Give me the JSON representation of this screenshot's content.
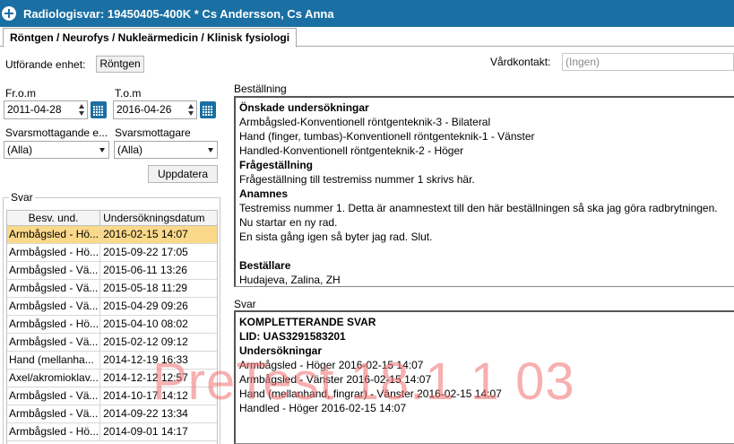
{
  "window": {
    "title": "Radiologisvar: 19450405-400K * Cs Andersson, Cs Anna",
    "icon": "medical-cross-icon"
  },
  "tabs": [
    {
      "label": "Röntgen / Neurofys / Nukleärmedicin / Klinisk fysiologi"
    }
  ],
  "filters": {
    "unit_label": "Utförande enhet:",
    "unit_value": "Röntgen",
    "vardkontakt_label": "Vårdkontakt:",
    "vardkontakt_placeholder": "(Ingen)",
    "from_label": "Fr.o.m",
    "from_value": "2011-04-28",
    "to_label": "T.o.m",
    "to_value": "2016-04-26",
    "recipient_unit_label": "Svarsmottagande e...",
    "recipient_unit_value": "(Alla)",
    "recipient_label": "Svarsmottagare",
    "recipient_value": "(Alla)",
    "update_label": "Uppdatera"
  },
  "answers_list": {
    "group_label": "Svar",
    "columns": [
      "Besv. und.",
      "Undersökningsdatum"
    ],
    "rows": [
      {
        "exam": "Armbågsled - Hö...",
        "date": "2016-02-15 14:07",
        "selected": true
      },
      {
        "exam": "Armbågsled - Hö...",
        "date": "2015-09-22 17:05"
      },
      {
        "exam": "Armbågsled - Vä...",
        "date": "2015-06-11 13:26"
      },
      {
        "exam": "Armbågsled - Vä...",
        "date": "2015-05-18 11:29"
      },
      {
        "exam": "Armbågsled - Vä...",
        "date": "2015-04-29 09:26"
      },
      {
        "exam": "Armbågsled - Hö...",
        "date": "2015-04-10 08:02"
      },
      {
        "exam": "Armbågsled - Vä...",
        "date": "2015-02-12 09:12"
      },
      {
        "exam": "Hand (mellanha...",
        "date": "2014-12-19 16:33"
      },
      {
        "exam": "Axel/akromioklav...",
        "date": "2014-12-12 12:57"
      },
      {
        "exam": "Armbågsled - Vä...",
        "date": "2014-10-17 14:12"
      },
      {
        "exam": "Armbågsled - Vä...",
        "date": "2014-09-22 13:34"
      },
      {
        "exam": "Armbågsled - Hö...",
        "date": "2014-09-01 14:17"
      }
    ]
  },
  "order_panel": {
    "label": "Beställning",
    "lines": [
      {
        "text": "Önskade undersökningar",
        "bold": true
      },
      {
        "text": "Armbågsled-Konventionell röntgenteknik-3 - Bilateral"
      },
      {
        "text": "Hand (finger, tumbas)-Konventionell röntgenteknik-1 - Vänster"
      },
      {
        "text": "Handled-Konventionell röntgenteknik-2 - Höger"
      },
      {
        "text": "Frågeställning",
        "bold": true
      },
      {
        "text": "Frågeställning till testremiss nummer 1 skrivs här."
      },
      {
        "text": "Anamnes",
        "bold": true
      },
      {
        "text": "Testremiss nummer 1. Detta är anamnestext till den här beställningen så ska jag göra radbrytningen."
      },
      {
        "text": "Nu startar en ny rad."
      },
      {
        "text": "En sista gång igen så byter jag rad. Slut."
      },
      {
        "text": ""
      },
      {
        "text": "Beställare",
        "bold": true
      },
      {
        "text": "Hudajeva, Zalina, ZH"
      }
    ]
  },
  "answer_panel": {
    "label": "Svar",
    "lines": [
      {
        "text": "KOMPLETTERANDE SVAR",
        "bold": true
      },
      {
        "text": "LID: UAS3291583201",
        "bold": true
      },
      {
        "text": "Undersökningar",
        "bold": true
      },
      {
        "text": "Armbågsled - Höger 2016-02-15 14:07"
      },
      {
        "text": "Armbågsled - Vänster 2016-02-15 14:07"
      },
      {
        "text": "Hand (mellanhand, fingrar) - Vänster 2016-02-15 14:07"
      },
      {
        "text": "Handled - Höger 2016-02-15 14:07"
      }
    ]
  },
  "watermark": "PreTest 18.1 1 03"
}
